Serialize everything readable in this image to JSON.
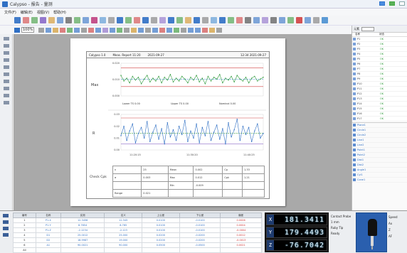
{
  "window": {
    "title": "Calypso - 报告 - 量测"
  },
  "menu": {
    "items": [
      "文件(F)",
      "编辑(E)",
      "视图(V)",
      "帮助(H)"
    ]
  },
  "toolbar2": {
    "zoom": "100%"
  },
  "report": {
    "header_left": "Calypso 1.0",
    "header_mid": "Meas. Report  11:20",
    "header_date": "2021-09-27",
    "header_right": "12:34  2021-09-27",
    "chart1_label": "Max",
    "chart2_label": "R",
    "chart1_stats": [
      "Lower TS 0.00",
      "Upper TS 0.00",
      "Nominal 0.00"
    ],
    "chart1_yticks": [
      "0.020",
      "0.010",
      "0.000"
    ],
    "chart2_yticks": [
      "0.03",
      "0.02",
      "0.01",
      "0.00"
    ],
    "chart2_xlabels": [
      "11:20:15",
      "11:30:20",
      "11:40:25"
    ],
    "table_label": "Check Cpk",
    "table_rows": [
      [
        "n",
        "25",
        "Mean",
        "0.002",
        "Cp",
        "1.33"
      ],
      [
        "σ",
        "0.003",
        "Max",
        "0.012",
        "Cpk",
        "1.21"
      ],
      [
        "",
        "",
        "Min",
        "-0.009",
        "",
        ""
      ],
      [
        "Range",
        "0.021",
        "",
        "",
        "",
        ""
      ]
    ]
  },
  "chart_data": [
    {
      "type": "line",
      "title": "",
      "ylabel": "Max",
      "ylim": [
        -0.01,
        0.025
      ],
      "x": [
        1,
        2,
        3,
        4,
        5,
        6,
        7,
        8,
        9,
        10,
        11,
        12,
        13,
        14,
        15,
        16,
        17,
        18,
        19,
        20,
        21,
        22,
        23,
        24,
        25,
        26,
        27,
        28,
        29,
        30,
        31,
        32,
        33,
        34,
        35,
        36,
        37,
        38,
        39,
        40,
        41,
        42,
        43,
        44,
        45,
        46,
        47,
        48,
        49,
        50
      ],
      "series": [
        {
          "values": [
            0.012,
            0.006,
            0.009,
            0.004,
            0.011,
            0.007,
            0.01,
            0.003,
            0.008,
            0.012,
            0.005,
            0.009,
            0.006,
            0.011,
            0.004,
            0.01,
            0.007,
            0.013,
            0.005,
            0.009,
            0.006,
            0.011,
            0.008,
            0.004,
            0.01,
            0.007,
            0.012,
            0.005,
            0.009,
            0.003,
            0.011,
            0.006,
            0.01,
            0.008,
            0.013,
            0.004,
            0.009,
            0.007,
            0.011,
            0.005,
            0.012,
            0.008,
            0.006,
            0.01,
            0.004,
            0.009,
            0.011,
            0.006,
            0.008,
            0.01
          ]
        }
      ]
    },
    {
      "type": "line",
      "title": "",
      "ylabel": "R",
      "ylim": [
        0.0,
        0.03
      ],
      "x": [
        1,
        2,
        3,
        4,
        5,
        6,
        7,
        8,
        9,
        10,
        11,
        12,
        13,
        14,
        15,
        16,
        17,
        18,
        19,
        20,
        21,
        22,
        23,
        24,
        25,
        26,
        27,
        28,
        29,
        30,
        31,
        32,
        33,
        34,
        35,
        36,
        37,
        38,
        39,
        40,
        41,
        42,
        43,
        44,
        45,
        46,
        47,
        48,
        49,
        50
      ],
      "series": [
        {
          "values": [
            0.012,
            0.02,
            0.008,
            0.016,
            0.022,
            0.006,
            0.014,
            0.019,
            0.01,
            0.024,
            0.007,
            0.015,
            0.021,
            0.009,
            0.018,
            0.005,
            0.023,
            0.011,
            0.017,
            0.008,
            0.02,
            0.013,
            0.025,
            0.007,
            0.016,
            0.01,
            0.022,
            0.006,
            0.019,
            0.012,
            0.024,
            0.008,
            0.015,
            0.021,
            0.009,
            0.018,
            0.005,
            0.023,
            0.011,
            0.017,
            0.026,
            0.008,
            0.02,
            0.013,
            0.019,
            0.007,
            0.016,
            0.022,
            0.01,
            0.014
          ]
        }
      ]
    }
  ],
  "right_panel": {
    "tab": "元素",
    "col1": "名称",
    "col2": "状态",
    "items": [
      {
        "name": "P1",
        "val": "OK"
      },
      {
        "name": "P2",
        "val": "OK"
      },
      {
        "name": "P3",
        "val": "OK"
      },
      {
        "name": "P4",
        "val": "OK"
      },
      {
        "name": "P5",
        "val": "OK"
      },
      {
        "name": "P6",
        "val": "OK"
      },
      {
        "name": "P7",
        "val": "OK"
      },
      {
        "name": "P8",
        "val": "OK"
      },
      {
        "name": "P9",
        "val": "OK"
      },
      {
        "name": "P10",
        "val": "OK"
      },
      {
        "name": "P11",
        "val": "OK"
      },
      {
        "name": "P12",
        "val": "OK"
      },
      {
        "name": "P13",
        "val": "OK"
      },
      {
        "name": "P14",
        "val": "OK"
      },
      {
        "name": "P15",
        "val": "OK"
      },
      {
        "name": "P16",
        "val": "OK"
      },
      {
        "name": "P17",
        "val": "OK"
      }
    ],
    "lower_items": [
      {
        "name": "Plane1"
      },
      {
        "name": "Circle1"
      },
      {
        "name": "Circle2"
      },
      {
        "name": "Line1"
      },
      {
        "name": "Line2"
      },
      {
        "name": "Point1"
      },
      {
        "name": "Point2"
      },
      {
        "name": "Dist1"
      },
      {
        "name": "Dist2"
      },
      {
        "name": "Angle1"
      },
      {
        "name": "Cyl1"
      },
      {
        "name": "Cone1"
      }
    ]
  },
  "data_table": {
    "headers": [
      "编号",
      "名称",
      "实测",
      "名义",
      "上公差",
      "下公差",
      "偏差"
    ],
    "rows": [
      [
        "1",
        "P1.X",
        "12.3456",
        "12.345",
        "0.0100",
        "-0.0100",
        "0.0006"
      ],
      [
        "2",
        "P1.Y",
        "8.7654",
        "8.765",
        "0.0100",
        "-0.0100",
        "0.0004"
      ],
      [
        "3",
        "P1.Z",
        "-2.1234",
        "-2.123",
        "0.0100",
        "-0.0100",
        "-0.0004"
      ],
      [
        "4",
        "D1",
        "25.0012",
        "25.000",
        "0.0200",
        "-0.0200",
        "0.0012"
      ],
      [
        "5",
        "D2",
        "18.9987",
        "19.000",
        "0.0200",
        "-0.0200",
        "-0.0013"
      ],
      [
        "6",
        "A1",
        "90.0021",
        "90.000",
        "0.0500",
        "-0.0500",
        "0.0021"
      ],
      [
        "All",
        "",
        "",
        "",
        "",
        "",
        ""
      ]
    ]
  },
  "dro": {
    "x_label": "X",
    "x": "181.3411",
    "y_label": "Y",
    "y": "179.4493",
    "z_label": "Z",
    "z": "-76.7042",
    "info1": "Contact Probe",
    "info2": "1 mm",
    "info3": "Ruby Tip",
    "info4": "Ready",
    "far1": "Speed",
    "far2": "Ax",
    "far3": "Z",
    "far4": "AF"
  }
}
